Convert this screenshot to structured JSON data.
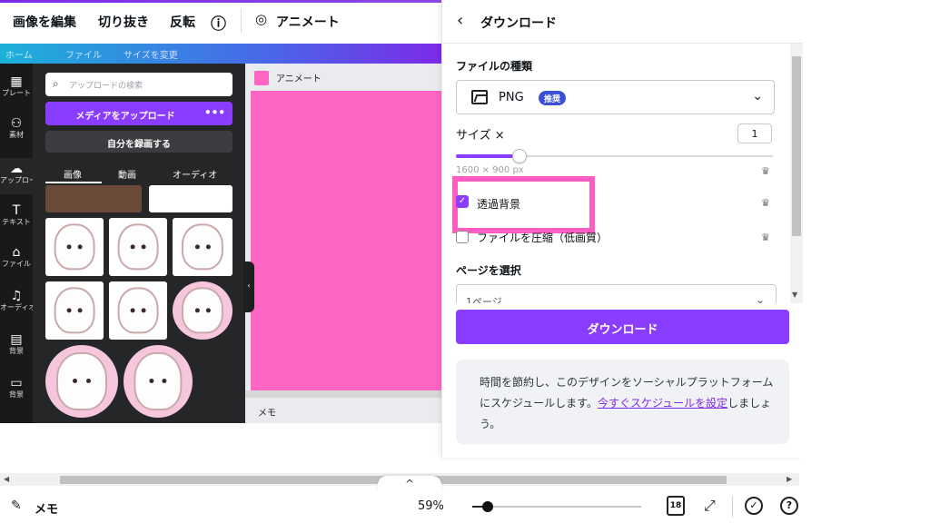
{
  "toolbar": {
    "edit_image": "画像を編集",
    "crop": "切り抜き",
    "flip": "反転",
    "info_icon": "ⓘ",
    "animate": "アニメート"
  },
  "editor_bg": {
    "blue_bar": [
      "ホーム",
      "ファイル",
      "サイズを変更"
    ],
    "rail": [
      {
        "icon": "▦",
        "label": "プレート"
      },
      {
        "icon": "⚇",
        "label": "素材"
      },
      {
        "icon": "☁",
        "label": "アップロード"
      },
      {
        "icon": "T",
        "label": "テキスト"
      },
      {
        "icon": "⌂",
        "label": "ファイル"
      },
      {
        "icon": "♫",
        "label": "オーディオ"
      },
      {
        "icon": "▤",
        "label": "背景"
      },
      {
        "icon": "▭",
        "label": "背景"
      }
    ],
    "search_placeholder": "アップロードの検索",
    "upload_button": "メディアをアップロード",
    "upload_more": "•••",
    "record_button": "自分を録画する",
    "media_tabs": [
      "画像",
      "動画",
      "オーディオ"
    ],
    "animate_mini": "アニメート",
    "memo_mini": "メモ"
  },
  "download_panel": {
    "back_icon": "‹",
    "title": "ダウンロード",
    "file_type_label": "ファイルの種類",
    "file_type_value": "PNG",
    "file_type_badge": "推奨",
    "size_label": "サイズ ×",
    "size_value": "1",
    "size_slider_fraction": 0.2,
    "dimensions": "1600 × 900 px",
    "transparent_bg_label": "透過背景",
    "transparent_bg_checked": true,
    "compress_label": "ファイルを圧縮（低画質）",
    "compress_checked": false,
    "crown_icon": "♛",
    "page_select_label": "ページを選択",
    "page_select_value": "1ページ",
    "download_button": "ダウンロード",
    "promo_text": "時間を節約し、このデザインをソーシャルプラットフォームにスケジュールします。",
    "promo_link": "今すぐスケジュールを設定",
    "promo_tail": "しましょう。"
  },
  "bottom": {
    "collapse_icon": "^",
    "memo": "メモ",
    "zoom": "59%",
    "zoom_fraction": 0.09,
    "pages_count": "18"
  },
  "colors": {
    "accent": "#8b3dff",
    "canvas_pink": "#ff66c4",
    "highlight_pink": "#ff5cc4",
    "badge_blue": "#3a50d9"
  }
}
